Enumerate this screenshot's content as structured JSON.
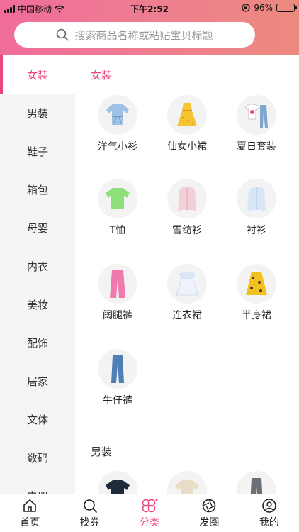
{
  "status_bar": {
    "carrier": "中国移动",
    "time": "下午2:52",
    "battery": "96%",
    "battery_level": 0.96
  },
  "search": {
    "placeholder": "搜索商品名称或粘贴宝贝标题"
  },
  "sidebar": {
    "items": [
      {
        "label": "女装",
        "active": true
      },
      {
        "label": "男装"
      },
      {
        "label": "鞋子"
      },
      {
        "label": "箱包"
      },
      {
        "label": "母婴"
      },
      {
        "label": "内衣"
      },
      {
        "label": "美妆"
      },
      {
        "label": "配饰"
      },
      {
        "label": "居家"
      },
      {
        "label": "文体"
      },
      {
        "label": "数码"
      },
      {
        "label": "电器"
      }
    ]
  },
  "sections": [
    {
      "title": "女装",
      "items": [
        {
          "label": "洋气小衫",
          "icon": "blouse-icon"
        },
        {
          "label": "仙女小裙",
          "icon": "dress-icon"
        },
        {
          "label": "夏日套装",
          "icon": "outfit-icon"
        },
        {
          "label": "T恤",
          "icon": "tshirt-icon"
        },
        {
          "label": "雪纺衫",
          "icon": "chiffon-shirt-icon"
        },
        {
          "label": "衬衫",
          "icon": "shirt-icon"
        },
        {
          "label": "阔腿裤",
          "icon": "wide-pants-icon"
        },
        {
          "label": "连衣裙",
          "icon": "dress-icon"
        },
        {
          "label": "半身裙",
          "icon": "skirt-icon"
        },
        {
          "label": "牛仔裤",
          "icon": "jeans-icon"
        }
      ]
    },
    {
      "title": "男装"
    }
  ],
  "tabbar": {
    "tabs": [
      {
        "label": "首页",
        "icon": "home-icon"
      },
      {
        "label": "找券",
        "icon": "search-icon"
      },
      {
        "label": "分类",
        "icon": "category-icon",
        "active": true
      },
      {
        "label": "发圈",
        "icon": "aperture-icon"
      },
      {
        "label": "我的",
        "icon": "profile-icon"
      }
    ]
  },
  "colors": {
    "accent": "#e9467d",
    "header_start": "#f06c9b",
    "header_end": "#ec8a7e"
  }
}
